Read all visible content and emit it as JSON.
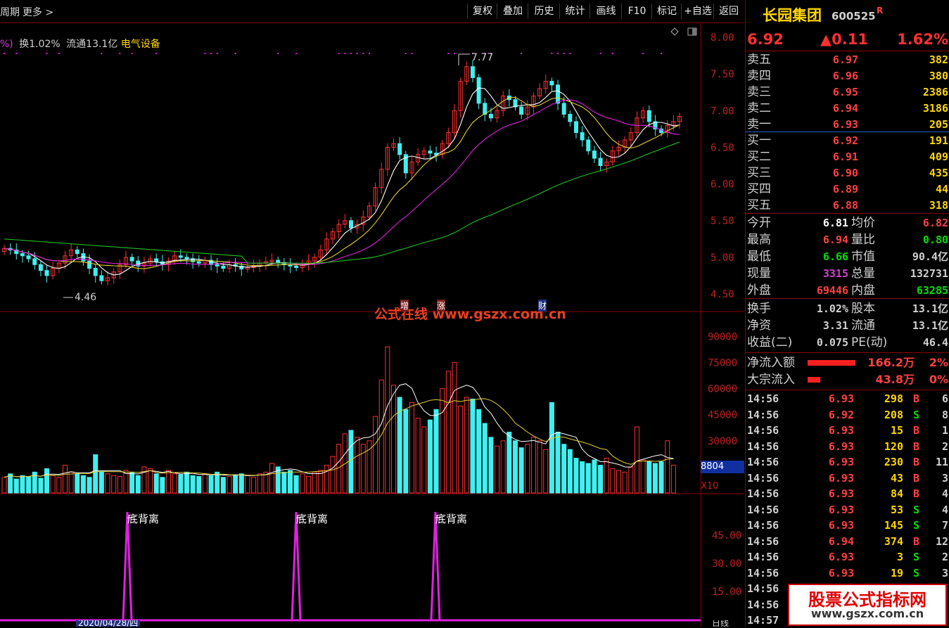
{
  "topbar": {
    "left_cut": "周期",
    "more": "更多 >",
    "buttons": [
      "复权",
      "叠加",
      "历史",
      "统计",
      "画线",
      "F10",
      "标记",
      "+自选",
      "返回"
    ]
  },
  "info_line": {
    "prefix": "%)",
    "turnover": "换1.02%",
    "float": "流通13.1亿",
    "sector": "电气设备"
  },
  "price_axis": [
    "8.00",
    "7.50",
    "7.00",
    "6.50",
    "6.00",
    "5.50",
    "5.00",
    "4.50"
  ],
  "volume_axis": [
    "90000",
    "75000",
    "60000",
    "45000",
    "30000",
    "15000"
  ],
  "volume_readout": "8804",
  "volume_unit": "X10",
  "indicator_axis": [
    "45.00",
    "30.00",
    "15.00"
  ],
  "annotations": {
    "high": "7.77",
    "low": "4.46",
    "signal": "底背离",
    "markers": [
      "增",
      "涨",
      "财"
    ],
    "watermark": "公式在线 www.gszx.com.cn"
  },
  "date_strip": {
    "first_date": "2020/04/28/四",
    "right_label": "日线"
  },
  "chart_data": {
    "type": "candlestick",
    "ylim": [
      4.3,
      8.1
    ],
    "series_price": {
      "open": [
        5.08,
        5.12,
        5.1,
        5.05,
        5.02,
        4.98,
        4.9,
        4.82,
        4.75,
        4.85,
        4.92,
        5.02,
        5.1,
        5.05,
        4.95,
        4.85,
        4.75,
        4.68,
        4.72,
        4.8,
        4.9,
        5.0,
        4.95,
        4.88,
        4.92,
        4.98,
        4.94,
        4.9,
        4.95,
        5.02,
        5.0,
        4.98,
        4.94,
        4.92,
        4.96,
        4.9,
        4.88,
        4.85,
        4.9,
        4.88,
        4.84,
        4.86,
        4.88,
        4.92,
        4.94,
        4.96,
        4.92,
        4.9,
        4.88,
        4.86,
        4.9,
        4.95,
        5.0,
        5.1,
        5.25,
        5.35,
        5.45,
        5.5,
        5.4,
        5.45,
        5.55,
        5.7,
        5.95,
        6.2,
        6.5,
        6.55,
        6.4,
        6.15,
        6.3,
        6.4,
        6.45,
        6.42,
        6.4,
        6.55,
        6.7,
        7.0,
        7.4,
        7.6,
        7.45,
        7.1,
        6.95,
        6.9,
        7.0,
        7.2,
        7.15,
        7.05,
        6.95,
        7.05,
        7.2,
        7.3,
        7.4,
        7.35,
        7.1,
        6.95,
        6.85,
        6.7,
        6.6,
        6.45,
        6.35,
        6.25,
        6.3,
        6.45,
        6.5,
        6.6,
        6.7,
        6.9,
        7.0,
        6.85,
        6.75,
        6.7,
        6.8,
        6.85
      ],
      "close": [
        5.12,
        5.1,
        5.05,
        5.02,
        4.98,
        4.9,
        4.82,
        4.75,
        4.85,
        4.92,
        5.02,
        5.1,
        5.05,
        4.95,
        4.85,
        4.75,
        4.68,
        4.72,
        4.8,
        4.9,
        5.0,
        4.95,
        4.88,
        4.92,
        4.98,
        4.94,
        4.9,
        4.95,
        5.02,
        5.0,
        4.98,
        4.94,
        4.92,
        4.96,
        4.9,
        4.88,
        4.85,
        4.9,
        4.88,
        4.84,
        4.86,
        4.88,
        4.92,
        4.94,
        4.96,
        4.92,
        4.9,
        4.88,
        4.86,
        4.9,
        4.95,
        5.0,
        5.1,
        5.25,
        5.35,
        5.45,
        5.5,
        5.4,
        5.45,
        5.55,
        5.7,
        5.95,
        6.2,
        6.5,
        6.55,
        6.4,
        6.15,
        6.3,
        6.4,
        6.45,
        6.42,
        6.4,
        6.55,
        6.7,
        7.0,
        7.4,
        7.6,
        7.45,
        7.1,
        6.95,
        6.9,
        7.0,
        7.2,
        7.15,
        7.05,
        6.95,
        7.05,
        7.2,
        7.3,
        7.4,
        7.35,
        7.1,
        6.95,
        6.85,
        6.7,
        6.6,
        6.45,
        6.35,
        6.25,
        6.3,
        6.45,
        6.5,
        6.6,
        6.7,
        6.9,
        7.0,
        6.85,
        6.75,
        6.7,
        6.8,
        6.85,
        6.92
      ]
    },
    "volume_ylim": [
      0,
      95000
    ],
    "volume": [
      9000,
      11000,
      8000,
      10000,
      9500,
      12000,
      8500,
      14000,
      10000,
      9000,
      16000,
      12000,
      11000,
      10000,
      9000,
      22000,
      12000,
      11000,
      10000,
      9500,
      13000,
      12000,
      10000,
      15000,
      14000,
      11000,
      9000,
      13000,
      11000,
      10500,
      12000,
      10000,
      9500,
      11000,
      10000,
      12000,
      9000,
      9500,
      10500,
      11000,
      10000,
      9000,
      11000,
      12000,
      17000,
      15000,
      12000,
      13000,
      10000,
      11000,
      9500,
      12000,
      13000,
      16000,
      21000,
      28000,
      34000,
      36000,
      32000,
      28000,
      30000,
      44000,
      65000,
      84000,
      62000,
      55000,
      48000,
      52000,
      43000,
      38000,
      42000,
      48000,
      60000,
      70000,
      75000,
      50000,
      55000,
      54000,
      48000,
      40000,
      32000,
      27000,
      30000,
      35000,
      30000,
      26000,
      28000,
      32000,
      30000,
      25000,
      52000,
      35000,
      28000,
      25000,
      20000,
      18000,
      17000,
      19000,
      16000,
      20000,
      14000,
      13000,
      12000,
      15000,
      38000,
      19000,
      18000,
      17000,
      18000,
      30000,
      16000
    ]
  },
  "quote": {
    "name": "长园集团",
    "code": "600525",
    "flag": "R",
    "price": "6.92",
    "change": "▲0.11",
    "pct": "1.62%",
    "asks": [
      {
        "label": "卖五",
        "price": "6.97",
        "vol": "382"
      },
      {
        "label": "卖四",
        "price": "6.96",
        "vol": "380"
      },
      {
        "label": "卖三",
        "price": "6.95",
        "vol": "2386"
      },
      {
        "label": "卖二",
        "price": "6.94",
        "vol": "3186"
      },
      {
        "label": "卖一",
        "price": "6.93",
        "vol": "205"
      }
    ],
    "bids": [
      {
        "label": "买一",
        "price": "6.92",
        "vol": "191"
      },
      {
        "label": "买二",
        "price": "6.91",
        "vol": "409"
      },
      {
        "label": "买三",
        "price": "6.90",
        "vol": "435"
      },
      {
        "label": "买四",
        "price": "6.89",
        "vol": "44"
      },
      {
        "label": "买五",
        "price": "6.88",
        "vol": "318"
      }
    ],
    "stats": [
      {
        "l1": "今开",
        "v1": "6.81",
        "c1": "#ffffff",
        "l2": "均价",
        "v2": "6.82",
        "c2": "#ff4040"
      },
      {
        "l1": "最高",
        "v1": "6.94",
        "c1": "#ff4040",
        "l2": "量比",
        "v2": "0.80",
        "c2": "#00e000"
      },
      {
        "l1": "最低",
        "v1": "6.66",
        "c1": "#00e000",
        "l2": "市值",
        "v2": "90.4亿",
        "c2": "#d0d0d0"
      },
      {
        "l1": "现量",
        "v1": "3315",
        "c1": "#d040d0",
        "l2": "总量",
        "v2": "132731",
        "c2": "#d0d0d0"
      },
      {
        "l1": "外盘",
        "v1": "69446",
        "c1": "#ff4040",
        "l2": "内盘",
        "v2": "63285",
        "c2": "#00e000"
      }
    ],
    "stats2": [
      {
        "l1": "换手",
        "v1": "1.02%",
        "l2": "股本",
        "v2": "13.1亿"
      },
      {
        "l1": "净资",
        "v1": "3.31",
        "l2": "流通",
        "v2": "13.1亿"
      },
      {
        "l1": "收益(二)",
        "v1": "0.075",
        "l2": "PE(动)",
        "v2": "46.4"
      }
    ],
    "flow": [
      {
        "label": "净流入额",
        "value": "166.2万",
        "pct": "2%"
      },
      {
        "label": "大宗流入",
        "value": "43.8万",
        "pct": "0%"
      }
    ],
    "ticks": [
      {
        "t": "14:56",
        "p": "6.93",
        "v": "298",
        "s": "B",
        "n": "6"
      },
      {
        "t": "14:56",
        "p": "6.92",
        "v": "208",
        "s": "S",
        "n": "8"
      },
      {
        "t": "14:56",
        "p": "6.93",
        "v": "15",
        "s": "B",
        "n": "1"
      },
      {
        "t": "14:56",
        "p": "6.93",
        "v": "120",
        "s": "B",
        "n": "2"
      },
      {
        "t": "14:56",
        "p": "6.93",
        "v": "230",
        "s": "B",
        "n": "11"
      },
      {
        "t": "14:56",
        "p": "6.93",
        "v": "43",
        "s": "B",
        "n": "3"
      },
      {
        "t": "14:56",
        "p": "6.93",
        "v": "84",
        "s": "B",
        "n": "4"
      },
      {
        "t": "14:56",
        "p": "6.93",
        "v": "53",
        "s": "S",
        "n": "4"
      },
      {
        "t": "14:56",
        "p": "6.93",
        "v": "145",
        "s": "S",
        "n": "7"
      },
      {
        "t": "14:56",
        "p": "6.94",
        "v": "374",
        "s": "B",
        "n": "12"
      },
      {
        "t": "14:56",
        "p": "6.93",
        "v": "3",
        "s": "S",
        "n": "2"
      },
      {
        "t": "14:56",
        "p": "6.93",
        "v": "19",
        "s": "S",
        "n": "3"
      },
      {
        "t": "14:56",
        "p": "",
        "v": "",
        "s": "",
        "n": ""
      },
      {
        "t": "14:56",
        "p": "",
        "v": "",
        "s": "",
        "n": ""
      },
      {
        "t": "14:57",
        "p": "",
        "v": "",
        "s": "",
        "n": ""
      }
    ]
  },
  "corner_watermark": {
    "line1": "股票公式指标网",
    "line2": "www.gszx.com.cn"
  },
  "colors": {
    "up": "#ff3030",
    "down": "#40f0f0",
    "ma5": "#ffffff",
    "ma10": "#e8d030",
    "ma20": "#e020e0",
    "ma60": "#20c020",
    "grid": "#8a0000"
  }
}
